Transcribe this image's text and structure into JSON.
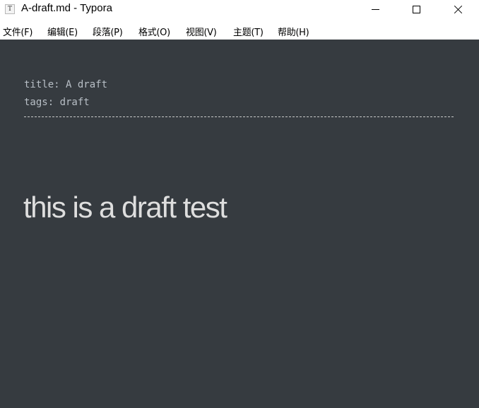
{
  "window": {
    "title": "A-draft.md - Typora",
    "app_icon_glyph": "T",
    "controls": {
      "minimize": "minimize-icon",
      "maximize": "maximize-icon",
      "close": "close-icon"
    }
  },
  "menubar": {
    "items": [
      {
        "label": "文件(F)"
      },
      {
        "label": "编辑(E)"
      },
      {
        "label": "段落(P)"
      },
      {
        "label": "格式(O)"
      },
      {
        "label": "视图(V)"
      },
      {
        "label": "主题(T)"
      },
      {
        "label": "帮助(H)"
      }
    ]
  },
  "document": {
    "front_matter": {
      "title_line": "title: A draft",
      "tags_line": "tags: draft"
    },
    "heading": "this is a draft test"
  },
  "theme": {
    "editor_background": "#363b40",
    "text_color": "#b8bfc6",
    "heading_color": "#dedede"
  }
}
